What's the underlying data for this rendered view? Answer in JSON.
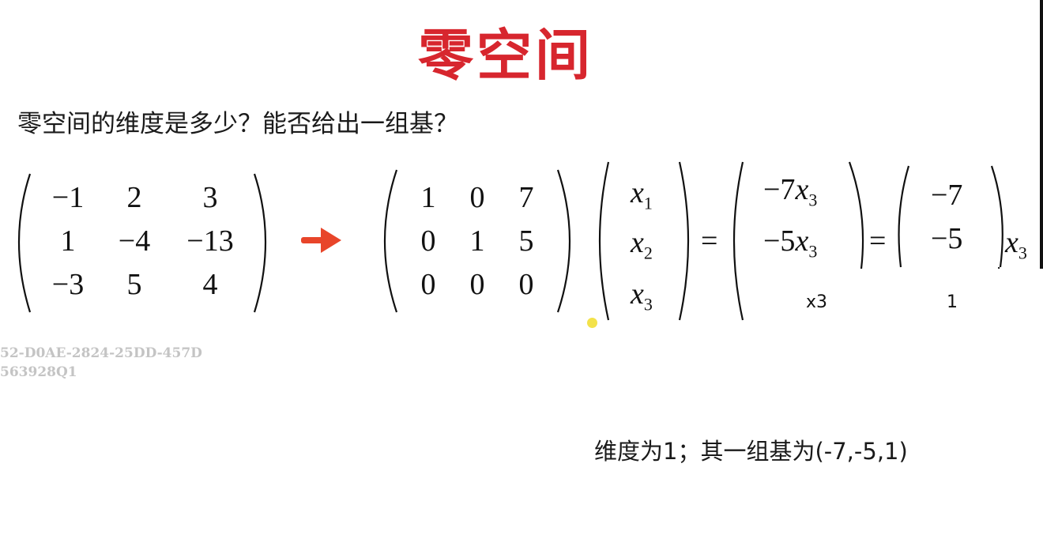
{
  "title": "零空间",
  "question": "零空间的维度是多少？能否给出一组基？",
  "matrix_a": [
    [
      "−1",
      "2",
      "3"
    ],
    [
      "1",
      "−4",
      "−13"
    ],
    [
      "−3",
      "5",
      "4"
    ]
  ],
  "matrix_r": [
    [
      "1",
      "0",
      "7"
    ],
    [
      "0",
      "1",
      "5"
    ],
    [
      "0",
      "0",
      "0"
    ]
  ],
  "vector_x": [
    "x",
    "1",
    "x",
    "2",
    "x",
    "3"
  ],
  "solution_vector": [
    "−7",
    "x",
    "3",
    "−5",
    "x",
    "3"
  ],
  "basis_vector": [
    "−7",
    "−5"
  ],
  "scalar": {
    "var": "x",
    "sub": "3"
  },
  "equals": "=",
  "handwritten": {
    "x3": "x3",
    "one": "1"
  },
  "watermark": [
    "52-D0AE-2824-25DD-457D",
    "563928Q1"
  ],
  "answer": "维度为1；其一组基为(-7,-5,1)",
  "colors": {
    "title": "#d7262e",
    "arrow": "#e8452a",
    "dot": "#f3e24a"
  },
  "icons": {
    "arrow": "right-arrow-icon"
  }
}
